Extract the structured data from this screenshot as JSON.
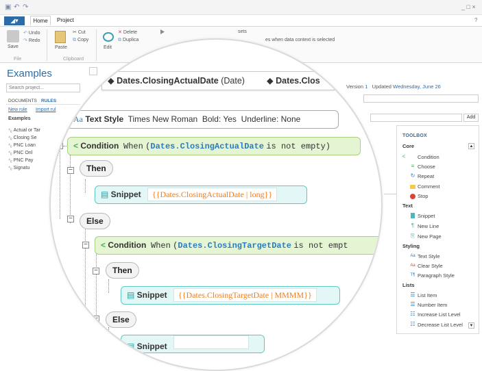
{
  "titlebar": {
    "controls": "_ □ ×",
    "help": "?"
  },
  "ribbon": {
    "tabs": [
      "Home",
      "Project"
    ],
    "save": "Save",
    "undo": "Undo",
    "redo": "Redo",
    "file_group": "File",
    "paste": "Paste",
    "cut": "Cut",
    "copy": "Copy",
    "clipboard_group": "Clipboard",
    "edit": "Edit",
    "delete": "Delete",
    "duplicate": "Duplica",
    "tip_fragment": "sets",
    "tip_text": "es when data context is selected"
  },
  "left": {
    "title": "Examples",
    "search_placeholder": "Search project...",
    "tabs": [
      "DOCUMENTS",
      "RULES"
    ],
    "links": [
      "New rule",
      "Import rul"
    ],
    "section": "Examples",
    "items": [
      "Actual or Tar",
      "Closing Se",
      "PNC Loan",
      "PNC Onl",
      "PNC Pay",
      "Signatu"
    ]
  },
  "doc": {
    "version_label": "Version",
    "version": "1",
    "updated_label": "Updated",
    "updated": "Wednesday, June 26",
    "add": "Add"
  },
  "toolbox": {
    "title": "TOOLBOX",
    "sections": [
      {
        "name": "Core",
        "items": [
          "Condition",
          "Choose",
          "Repeat",
          "Comment",
          "Stop"
        ]
      },
      {
        "name": "Text",
        "items": [
          "Snippet",
          "New Line",
          "New Page"
        ]
      },
      {
        "name": "Styling",
        "items": [
          "Text Style",
          "Clear Style",
          "Paragraph Style"
        ]
      },
      {
        "name": "Lists",
        "items": [
          "List Item",
          "Number Item",
          "Increase List Level",
          "Decrease List Level"
        ]
      }
    ]
  },
  "lens": {
    "field1": "Dates.ClosingActualDate",
    "field1_type": "(Date)",
    "field2": "Dates.Clos",
    "textstyle": {
      "prefix": "Aa",
      "label": "Text Style",
      "font": "Times New Roman",
      "bold": "Bold: Yes",
      "underline": "Underline: None"
    },
    "cond1": {
      "label": "Condition",
      "when": "When",
      "open": "(",
      "field": "Dates.ClosingActualDate",
      "rest": "is not empty)"
    },
    "then": "Then",
    "snippet1": {
      "label": "Snippet",
      "expr": "{{Dates.ClosingActualDate | long}}"
    },
    "else": "Else",
    "cond2": {
      "label": "Condition",
      "when": "When",
      "open": "(",
      "field": "Dates.ClosingTargetDate",
      "rest": "is not empt"
    },
    "then2": "Then",
    "snippet2": {
      "label": "Snippet",
      "expr": "{{Dates.ClosingTargetDate | MMMM}}"
    },
    "else2": "Else",
    "snippet3": {
      "label": "Snippet"
    }
  },
  "colors": {
    "accent": "#2b6ca8",
    "condition_bg": "#e5f4d3",
    "snippet_bg": "#e3f7f7",
    "field": "#2b7bbf",
    "expression": "#ee7c1d"
  }
}
